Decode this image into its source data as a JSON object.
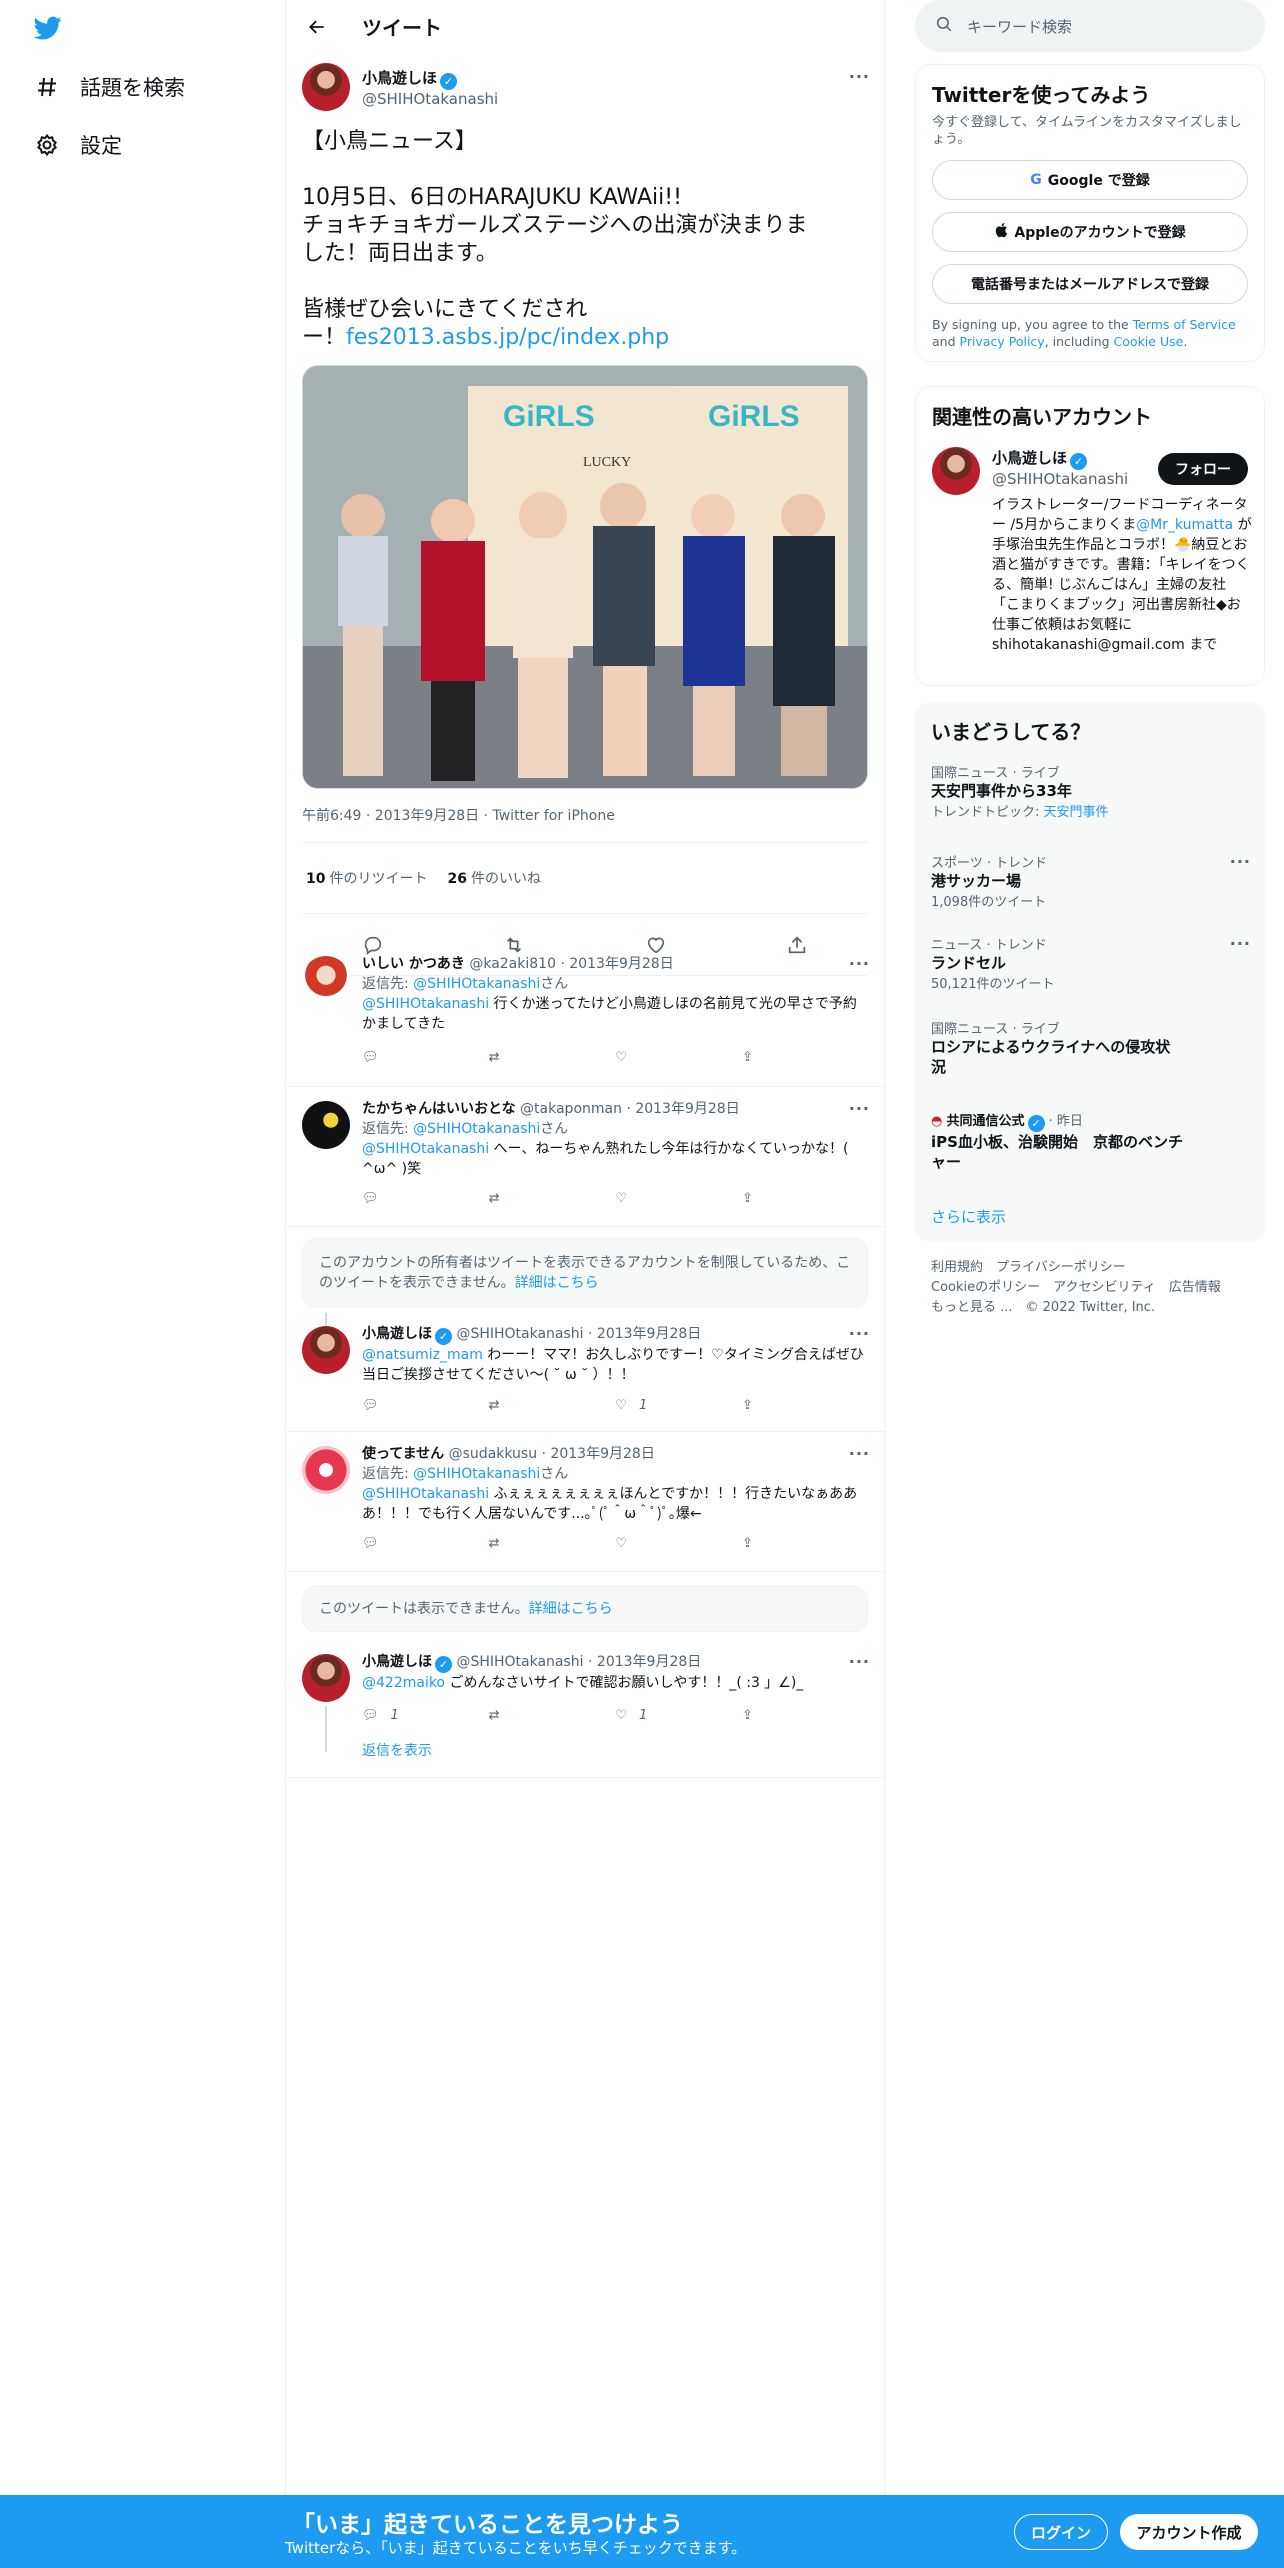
{
  "nav": {
    "explore": "話題を検索",
    "settings": "設定"
  },
  "header": {
    "title": "ツイート"
  },
  "main_tweet": {
    "name": "小鳥遊しほ",
    "handle": "@SHIHOtakanashi",
    "text_line1": "【小鳥ニュース】",
    "text_line2": "10月5日、6日のHARAJUKU KAWAii!!",
    "text_line3": "チョキチョキガールズステージへの出演が決まりま",
    "text_line4": "した！両日出ます。",
    "text_line5": "皆様ぜひ会いにきてくだされ",
    "text_line6_prefix": "ー！",
    "link": "fes2013.asbs.jp/pc/index.php",
    "meta": "午前6:49 · 2013年9月28日 · Twitter for iPhone",
    "retweets": "10",
    "retweets_label": "件のリツイート",
    "likes": "26",
    "likes_label": "件のいいね",
    "photo_banner_left": "GiRLS",
    "photo_banner_right": "GiRLS",
    "photo_sign": "LUCKY"
  },
  "replies": [
    {
      "name": "いしい かつあき",
      "handle": "@ka2aki810",
      "date": "· 2013年9月28日",
      "replying_prefix": "返信先: ",
      "replying_to": "@SHIHOtakanashi",
      "replying_suffix": "さん",
      "mention": "@SHIHOtakanashi",
      "text": " 行くか迷ってたけど小鳥遊しほの名前見て光の早さで予約かましてきた",
      "reply_count": "",
      "like_count": ""
    },
    {
      "name": "たかちゃんはいいおとな",
      "handle": "@takaponman",
      "date": "· 2013年9月28日",
      "replying_prefix": "返信先: ",
      "replying_to": "@SHIHOtakanashi",
      "replying_suffix": "さん",
      "mention": "@SHIHOtakanashi",
      "text": " へー、ねーちゃん熟れたし今年は行かなくていっかな！( ^ω^ )笑",
      "reply_count": "",
      "like_count": ""
    },
    {
      "name": "小鳥遊しほ",
      "handle": "@SHIHOtakanashi",
      "date": "· 2013年9月28日",
      "mention": "@natsumiz_mam",
      "text": " わーー！ママ！お久しぶりですー！♡タイミング合えばぜひ当日ご挨拶させてください～( ˘ ω ˘ ）！！",
      "reply_count": "",
      "like_count": "1"
    },
    {
      "name": "使ってません",
      "handle": "@sudakkusu",
      "date": "· 2013年9月28日",
      "replying_prefix": "返信先: ",
      "replying_to": "@SHIHOtakanashi",
      "replying_suffix": "さん",
      "mention": "@SHIHOtakanashi",
      "text": " ふぇぇぇぇぇぇぇぇほんとですか！！！行きたいなぁあああ！！！でも行く人居ないんです...｡ﾟ(ﾟ＾ω＾ﾟ)ﾟ｡爆←",
      "reply_count": "",
      "like_count": ""
    },
    {
      "name": "小鳥遊しほ",
      "handle": "@SHIHOtakanashi",
      "date": "· 2013年9月28日",
      "mention": "@422maiko",
      "text": " ごめんなさいサイトで確認お願いしやす！！_( :3 」∠)_",
      "reply_count": "1",
      "like_count": "1"
    }
  ],
  "notice1": {
    "text": "このアカウントの所有者はツイートを表示できるアカウントを制限しているため、このツイートを表示できません。",
    "link": "詳細はこちら"
  },
  "notice2": {
    "text": "このツイートは表示できません。",
    "link": "詳細はこちら"
  },
  "show_replies": "返信を表示",
  "right": {
    "search_placeholder": "キーワード検索",
    "signup_title": "Twitterを使ってみよう",
    "signup_sub": "今すぐ登録して、タイムラインをカスタマイズしましょう。",
    "google_btn": "Google で登録",
    "apple_btn": "Appleのアカウントで登録",
    "phone_btn": "電話番号またはメールアドレスで登録",
    "terms_1": "By signing up, you agree to the ",
    "terms_link1": "Terms of Service",
    "terms_2": " and ",
    "terms_link2": "Privacy Policy",
    "terms_3": ", including ",
    "terms_link3": "Cookie Use",
    "terms_4": ".",
    "related_title": "関連性の高いアカウント",
    "related_name": "小鳥遊しほ",
    "related_handle": "@SHIHOtakanashi",
    "follow": "フォロー",
    "bio_1": "イラストレーター/フードコーディネーター /5月からこまりくま",
    "bio_mention": "@Mr_kumatta",
    "bio_2": " が手塚治虫先生作品とコラボ！🐣納豆とお酒と猫がすきです。書籍：「キレイをつくる、簡単! じぶんごはん」主婦の友社「こまりくまブック」河出書房新社◆お仕事ご依頼はお気軽に shihotakanashi@gmail.com まで",
    "trends_title": "いまどうしてる？",
    "trends": [
      {
        "cat": "国際ニュース · ライブ",
        "title": "天安門事件から33年",
        "sub_prefix": "トレンドトピック: ",
        "sub_link": "天安門事件"
      },
      {
        "cat": "スポーツ · トレンド",
        "title": "港サッカー場",
        "sub": "1,098件のツイート"
      },
      {
        "cat": "ニュース · トレンド",
        "title": "ランドセル",
        "sub": "50,121件のツイート"
      },
      {
        "cat": "国際ニュース · ライブ",
        "title": "ロシアによるウクライナへの侵攻状況"
      },
      {
        "cat_name": "共同通信公式",
        "cat_time": " · 昨日",
        "title": "iPS血小板、治験開始　京都のベンチャー"
      }
    ],
    "show_more": "さらに表示",
    "footer_line1": "利用規約　プライバシーポリシー",
    "footer_line2": "Cookieのポリシー　アクセシビリティ　広告情報",
    "footer_line3": "もっと見る ...　© 2022 Twitter, Inc."
  },
  "bottom": {
    "title": "「いま」起きていることを見つけよう",
    "sub": "Twitterなら、「いま」起きていることをいち早くチェックできます。",
    "login": "ログイン",
    "signup": "アカウント作成"
  },
  "colors": {
    "accent": "#1d9bf0",
    "text": "#0f1419",
    "muted": "#536471"
  }
}
